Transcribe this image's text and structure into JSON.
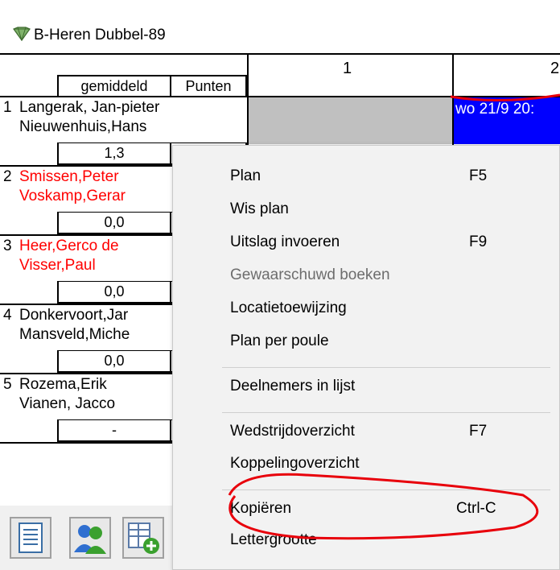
{
  "window": {
    "title": "B-Heren Dubbel-89"
  },
  "header": {
    "col_avg": "gemiddeld",
    "col_points": "Punten",
    "col1": "1",
    "col2": "2"
  },
  "date_cell": "wo 21/9 20:",
  "players": [
    {
      "num": "1",
      "line1": "Langerak, Jan-pieter",
      "line2": "Nieuwenhuis,Hans",
      "avg": "1,3",
      "color": "#000000"
    },
    {
      "num": "2",
      "line1": "Smissen,Peter",
      "line2": "Voskamp,Gerar",
      "avg": "0,0",
      "color": "#ff0000"
    },
    {
      "num": "3",
      "line1": "Heer,Gerco de",
      "line2": "Visser,Paul",
      "avg": "0,0",
      "color": "#ff0000"
    },
    {
      "num": "4",
      "line1": "Donkervoort,Jar",
      "line2": "Mansveld,Miche",
      "avg": "0,0",
      "color": "#000000"
    },
    {
      "num": "5",
      "line1": "Rozema,Erik",
      "line2": "Vianen, Jacco",
      "avg": "-",
      "color": "#000000"
    }
  ],
  "toolbar": {
    "icons": [
      "list-icon",
      "users-icon",
      "add-table-icon"
    ]
  },
  "context_menu": {
    "items": [
      {
        "label": "Plan",
        "shortcut": "F5"
      },
      {
        "label": "Wis plan",
        "shortcut": ""
      },
      {
        "label": "Uitslag invoeren",
        "shortcut": "F9"
      },
      {
        "label": "Gewaarschuwd boeken",
        "shortcut": "",
        "disabled": true
      },
      {
        "label": "Locatietoewijzing",
        "shortcut": ""
      },
      {
        "label": "Plan per poule",
        "shortcut": ""
      },
      {
        "label": "Deelnemers in lijst",
        "shortcut": ""
      },
      {
        "label": "Wedstrijdoverzicht",
        "shortcut": "F7"
      },
      {
        "label": "Koppelingoverzicht",
        "shortcut": ""
      },
      {
        "label": "Kopiëren",
        "shortcut": "Ctrl-C"
      },
      {
        "label": "Lettergrootte",
        "shortcut": ""
      }
    ]
  },
  "colors": {
    "selected_cell": "#0000ff",
    "empty_cell": "#c0c0c0",
    "annotation": "#e8000b",
    "red_player": "#ff0000"
  }
}
